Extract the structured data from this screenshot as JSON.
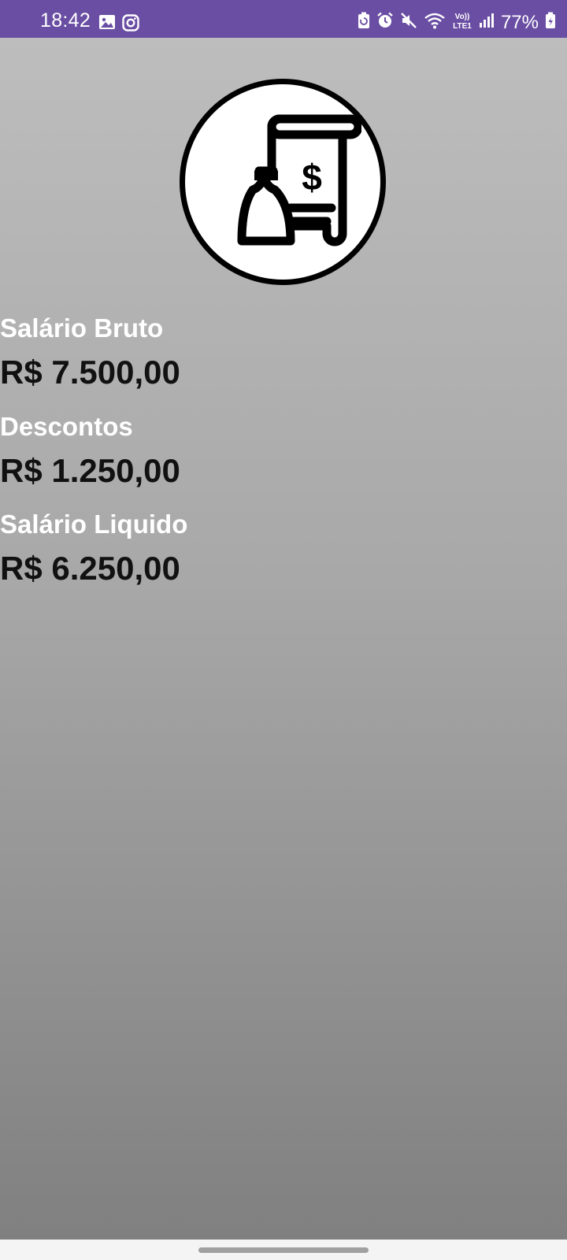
{
  "status_bar": {
    "time": "18:42",
    "battery": "77%",
    "background": "#6a4ea3",
    "left_icons": [
      "gallery-icon",
      "instagram-icon"
    ],
    "right_icons": [
      "battery-saver-icon",
      "alarm-icon",
      "mute-icon",
      "wifi-icon",
      "volte-icon",
      "signal-icon",
      "battery-icon"
    ],
    "volte_text": "Vo)) LTE1"
  },
  "logo": {
    "icon": "salary-scroll-dollar-icon"
  },
  "summary": {
    "gross_label": "Salário Bruto",
    "gross_value": "R$ 7.500,00",
    "discounts_label": "Descontos",
    "discounts_value": "R$ 1.250,00",
    "net_label": "Salário Liquido",
    "net_value": "R$ 6.250,00"
  }
}
